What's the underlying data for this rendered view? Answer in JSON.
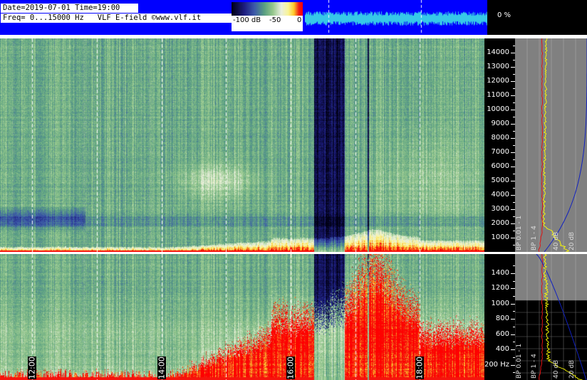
{
  "header": {
    "date_line": "Date=2019-07-01 Time=19:00",
    "freq_line": "Freq= 0...15000 Hz   VLF E-field ©www.vlf.it",
    "colorbar_labels": [
      "-100 dB",
      "-50",
      "0"
    ],
    "signal_percent": "0 %"
  },
  "colors": {
    "header_blue": "#0000ff",
    "strip_cyan": "#36c8e8",
    "grid_dashed": "#ffffff",
    "bp_red": "#e01010",
    "bp_yellow": "#ffff00",
    "bp_blue": "#1020c0",
    "bp_panel": "#808080"
  },
  "chart_data": [
    {
      "type": "heatmap",
      "title": "",
      "xlabel": "",
      "ylabel": "",
      "x_tick_labels": [
        "12:00",
        "14:00",
        "16:00",
        "18:00"
      ],
      "x_ticks_hours": [
        12,
        14,
        16,
        18
      ],
      "xlim_hours": [
        11.5,
        19.0
      ],
      "panels": [
        {
          "name": "",
          "ylim_hz": [
            0,
            15000
          ],
          "y_ticks": [
            1000,
            2000,
            3000,
            4000,
            5000,
            6000,
            7000,
            8000,
            9000,
            10000,
            11000,
            12000,
            13000,
            14000
          ],
          "y_tick_labels": [
            "1000",
            "2000",
            "3000",
            "4000",
            "5000",
            "6000",
            "7000",
            "8000",
            "9000",
            "10000",
            "11000",
            "12000",
            "13000",
            "14000"
          ]
        },
        {
          "name": "",
          "ylim_hz": [
            0,
            1650
          ],
          "y_ticks": [
            200,
            400,
            600,
            800,
            1000,
            1200,
            1400
          ],
          "y_tick_labels": [
            "200 Hz",
            "400",
            "600",
            "800",
            "1000",
            "1200",
            "1400"
          ]
        }
      ],
      "colorbar": {
        "range_db": [
          -100,
          0
        ],
        "labels": [
          "-100 dB",
          "-50",
          "0"
        ]
      }
    },
    {
      "type": "line",
      "title": "",
      "series_labels": [
        "BP 0.01 - 1",
        "BP 1 - 4",
        "40 dB",
        "20 dB"
      ]
    }
  ]
}
